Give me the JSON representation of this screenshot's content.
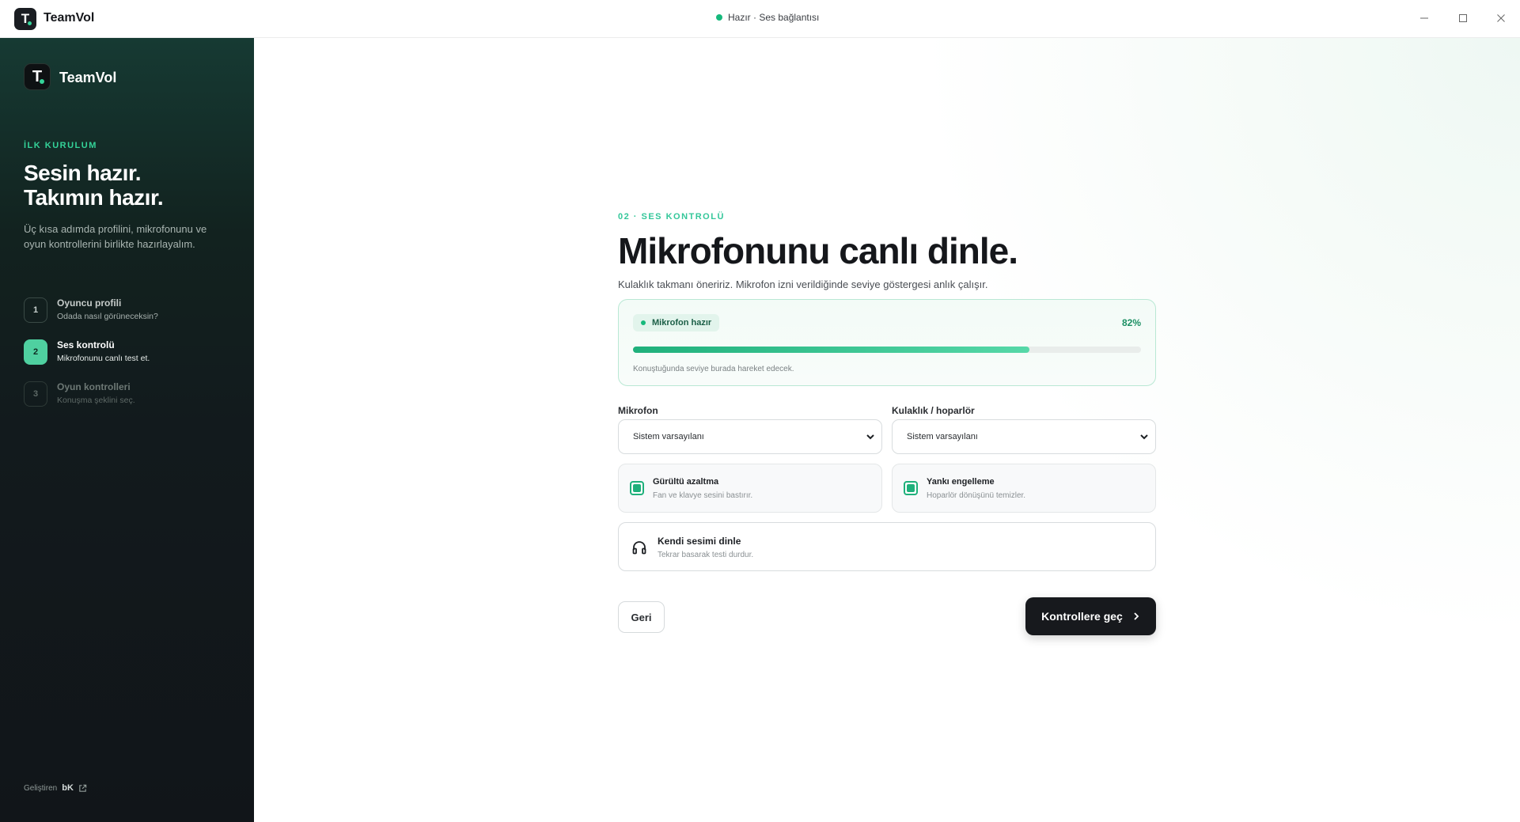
{
  "app": {
    "name": "TeamVol",
    "logo_letter": "T",
    "status_text": "Hazır · Ses bağlantısı",
    "window_controls": {
      "minimize": "—",
      "maximize": "☐",
      "close": "✕"
    }
  },
  "sidebar": {
    "brand": "TeamVol",
    "kicker": "İLK KURULUM",
    "title_line1": "Sesin hazır.",
    "title_line2": "Takımın hazır.",
    "description": "Üç kısa adımda profilini, mikrofonunu ve oyun kontrollerini birlikte hazırlayalım.",
    "steps": [
      {
        "number": "1",
        "label": "Oyuncu profili",
        "sub": "Odada nasıl görüneceksin?",
        "state": "done"
      },
      {
        "number": "2",
        "label": "Ses kontrolü",
        "sub": "Mikrofonunu canlı test et.",
        "state": "active"
      },
      {
        "number": "3",
        "label": "Oyun kontrolleri",
        "sub": "Konuşma şeklini seç.",
        "state": "upcoming"
      }
    ],
    "footer": {
      "prefix": "Geliştiren",
      "author": "bK"
    }
  },
  "main": {
    "kicker": "02 · SES KONTROLÜ",
    "headline": "Mikrofonunu canlı dinle.",
    "lead": "Kulaklık takmanı öneririz. Mikrofon izni verildiğinde seviye göstergesi anlık çalışır.",
    "meter": {
      "status": "Mikrofon hazır",
      "level_text": "82%",
      "level": 0.78,
      "hint": "Konuştuğunda seviye burada hareket edecek."
    },
    "microphone": {
      "label": "Mikrofon",
      "value": "Sistem varsayılanı"
    },
    "output": {
      "label": "Kulaklık / hoparlör",
      "value": "Sistem varsayılanı"
    },
    "options": {
      "noise": {
        "title": "Gürültü azaltma",
        "sub": "Fan ve klavye sesini bastırır.",
        "checked": true
      },
      "echo": {
        "title": "Yankı engelleme",
        "sub": "Hoparlör dönüşünü temizler.",
        "checked": true
      }
    },
    "monitor": {
      "title": "Kendi sesimi dinle",
      "sub": "Tekrar basarak testi durdur."
    },
    "back_label": "Geri",
    "next_label": "Kontrollere geç",
    "colors": {
      "accent": "#1fb07b",
      "accent_light": "#4fd0a0",
      "dark": "#17191d"
    }
  }
}
